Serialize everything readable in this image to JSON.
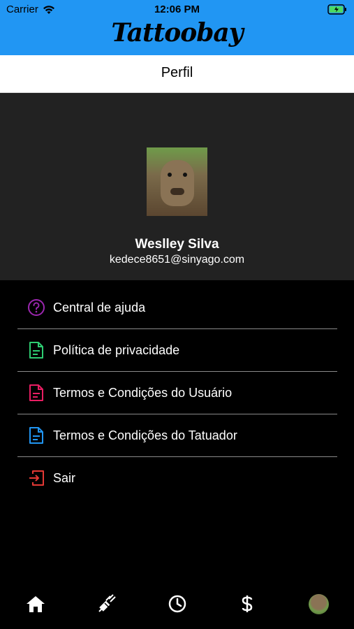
{
  "status_bar": {
    "carrier": "Carrier",
    "time": "12:06 PM"
  },
  "brand": {
    "logo_text": "Tattoobay"
  },
  "header": {
    "title": "Perfil"
  },
  "profile": {
    "name": "Weslley Silva",
    "email": "kedece8651@sinyago.com"
  },
  "menu": {
    "items": [
      {
        "label": "Central de ajuda",
        "icon": "help-circle-icon",
        "color": "#9c27b0"
      },
      {
        "label": "Política de privacidade",
        "icon": "document-icon",
        "color": "#2ecc71"
      },
      {
        "label": "Termos e Condições do Usuário",
        "icon": "document-icon",
        "color": "#e91e63"
      },
      {
        "label": "Termos e Condições do Tatuador",
        "icon": "document-icon",
        "color": "#2196f3"
      },
      {
        "label": "Sair",
        "icon": "logout-icon",
        "color": "#e53935"
      }
    ]
  },
  "tabbar": {
    "tabs": [
      {
        "icon": "home-icon"
      },
      {
        "icon": "tattoo-machine-icon"
      },
      {
        "icon": "clock-icon"
      },
      {
        "icon": "dollar-icon"
      },
      {
        "icon": "avatar-icon"
      }
    ]
  },
  "colors": {
    "topbar": "#2196f3",
    "profile_bg": "#222222",
    "background": "#000000"
  }
}
